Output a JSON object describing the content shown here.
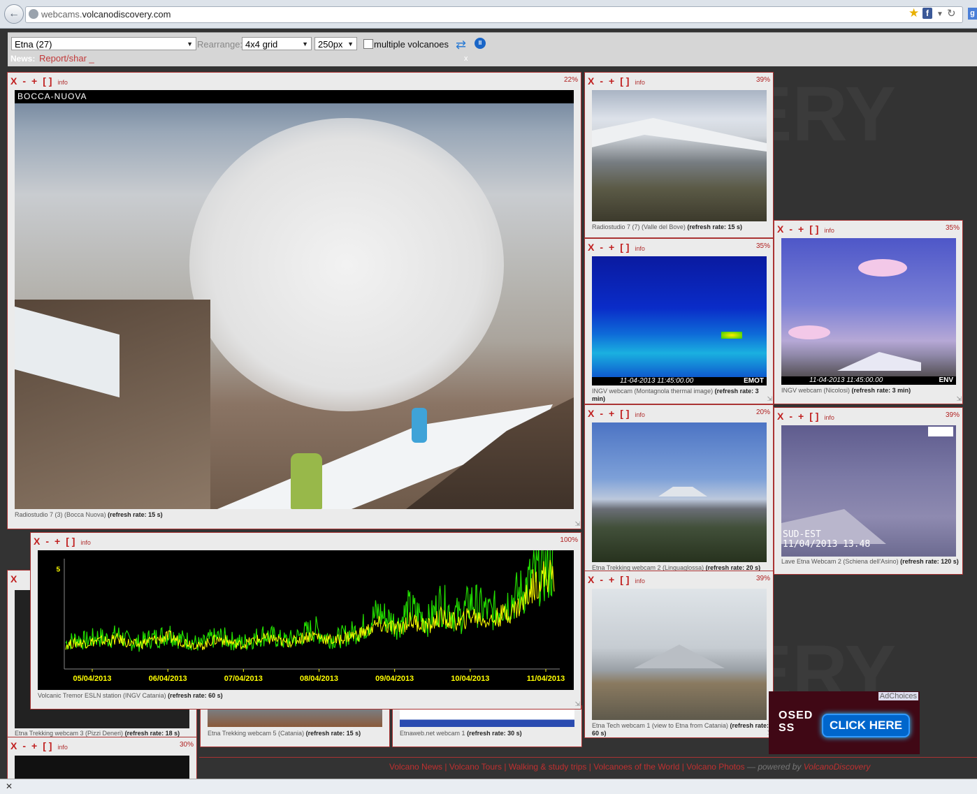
{
  "browser": {
    "url_subdomain": "webcams.",
    "url_domain": "volcanodiscovery.com"
  },
  "toolbar": {
    "volcano_selected": "Etna (27)",
    "rearrange_label": "Rearrange:",
    "grid_selected": "4x4 grid",
    "size_selected": "250px",
    "multiple_label": "multiple volcanoes",
    "news_label": "News:",
    "news_text": "Report/shar _",
    "news_close": "x"
  },
  "cam_controls": {
    "close": "X",
    "minus": "-",
    "plus": "+",
    "full": "[ ]",
    "info": "info"
  },
  "cams": [
    {
      "id": "bocca",
      "pct": "22%",
      "overlay": "BOCCA-NUOVA",
      "caption": "Radiostudio 7 (3) (Bocca Nuova)",
      "refresh": "(refresh rate: 15 s)"
    },
    {
      "id": "valle",
      "pct": "39%",
      "caption": "Radiostudio 7 (7) (Valle del Bove)",
      "refresh": "(refresh rate: 15 s)"
    },
    {
      "id": "thermal",
      "pct": "35%",
      "caption": "INGV webcam (Montagnola thermal image)",
      "refresh": "(refresh rate: 3 min)",
      "stamp": "11-04-2013  11:45:00.00",
      "tag": "EMOT"
    },
    {
      "id": "nicolosi",
      "pct": "35%",
      "caption": "INGV webcam (Nicolosi)",
      "refresh": "(refresh rate: 3 min)",
      "stamp": "11-04-2013  11:45:00.00",
      "tag": "ENV"
    },
    {
      "id": "linguaglossa",
      "pct": "20%",
      "caption": "Etna Trekking webcam 2 (Linguaglossa)",
      "refresh": "(refresh rate: 20 s)"
    },
    {
      "id": "asino",
      "pct": "39%",
      "caption": "Lave Etna Webcam 2 (Schiena dell'Asino)",
      "refresh": "(refresh rate: 120 s)",
      "stamp1": "SUD-EST",
      "stamp2": "11/04/2013 13.48"
    },
    {
      "id": "tremor",
      "pct": "100%",
      "caption": "Volcanic Tremor ESLN station (INGV Catania)",
      "refresh": "(refresh rate: 60 s)"
    },
    {
      "id": "catania",
      "pct": "39%",
      "caption": "Etna Tech webcam 1 (view to Etna from Catania)",
      "refresh": "(refresh rate: 60 s)"
    },
    {
      "id": "pizzi",
      "caption": "Etna Trekking webcam 3 (Pizzi Deneri)",
      "refresh": "(refresh rate: 18 s)"
    },
    {
      "id": "trek5",
      "caption": "Etna Trekking webcam 5 (Catania)",
      "refresh": "(refresh rate: 15 s)"
    },
    {
      "id": "etnaweb",
      "caption": "Etnaweb.net webcam 1",
      "refresh": "(refresh rate: 30 s)"
    },
    {
      "id": "bottom",
      "pct": "30%"
    }
  ],
  "chart_data": {
    "type": "line",
    "title": "",
    "xlabel": "",
    "ylabel": "",
    "y_tick_labels": [
      "5"
    ],
    "x_tick_labels": [
      "05/04/2013",
      "06/04/2013",
      "07/04/2013",
      "08/04/2013",
      "09/04/2013",
      "10/04/2013",
      "11/04/2013"
    ],
    "ylim": [
      0,
      5.5
    ],
    "background": "#000000",
    "series": [
      {
        "color": "#22dd00",
        "values": [
          1.3,
          1.5,
          1.4,
          1.6,
          1.5,
          1.7,
          1.4,
          1.3,
          1.5,
          1.6,
          1.8,
          1.5,
          1.4,
          1.2,
          1.5,
          1.6,
          1.4,
          1.3,
          1.5,
          1.7,
          1.6,
          1.4,
          1.5,
          1.8,
          2.0,
          1.6,
          1.5,
          1.7,
          1.9,
          2.2,
          2.8,
          2.5,
          2.2,
          3.0,
          2.7,
          2.4,
          3.3,
          2.9,
          2.6,
          3.4,
          3.0,
          2.8,
          3.2,
          3.5,
          3.9,
          4.6,
          4.9,
          5.0
        ]
      },
      {
        "color": "#ffff00",
        "values": [
          1.2,
          1.3,
          1.3,
          1.4,
          1.4,
          1.5,
          1.3,
          1.2,
          1.4,
          1.5,
          1.6,
          1.4,
          1.3,
          1.1,
          1.4,
          1.5,
          1.3,
          1.2,
          1.4,
          1.5,
          1.5,
          1.3,
          1.4,
          1.6,
          1.7,
          1.5,
          1.4,
          1.6,
          1.7,
          1.9,
          2.2,
          2.1,
          2.0,
          2.4,
          2.3,
          2.1,
          2.6,
          2.4,
          2.3,
          2.7,
          2.5,
          2.4,
          2.7,
          2.9,
          3.3,
          4.2,
          4.6,
          4.7
        ]
      }
    ]
  },
  "ad": {
    "choices": "AdChoices",
    "text_line1": "OSED",
    "text_line2": "SS",
    "button": "CLICK HERE"
  },
  "footer": {
    "links": [
      "Volcano News",
      "Volcano Tours",
      "Walking & study trips",
      "Volcanoes of the World",
      "Volcano Photos"
    ],
    "powered": "— powered by",
    "brand": "VolcanoDiscovery"
  },
  "background_brand": "ERY"
}
